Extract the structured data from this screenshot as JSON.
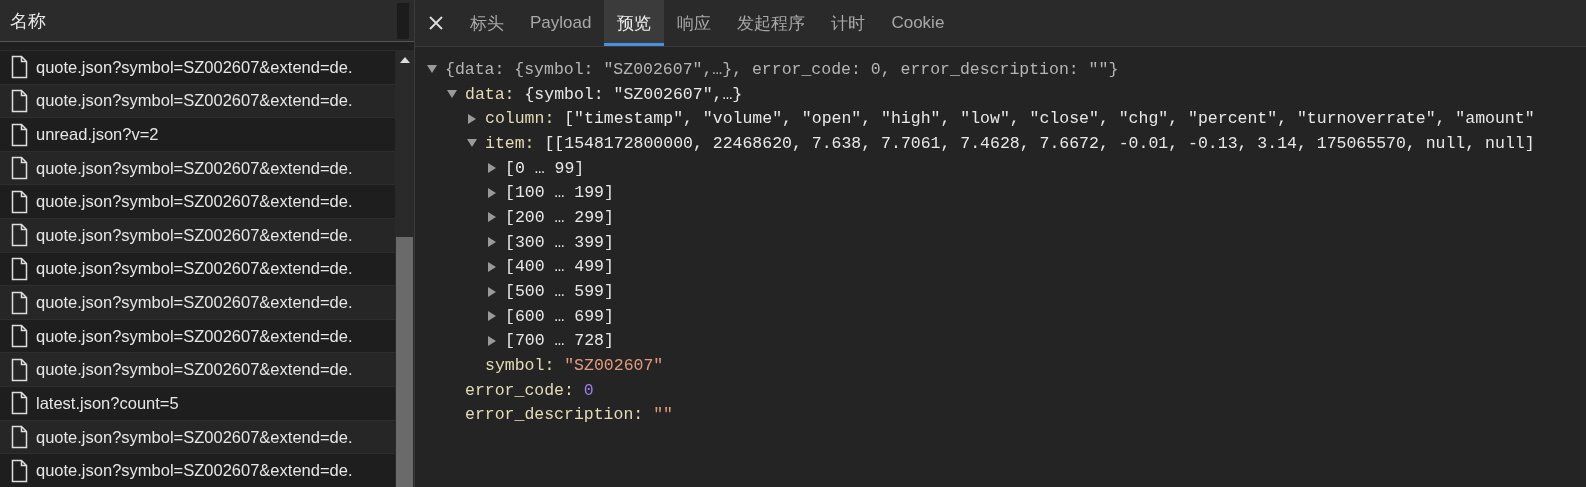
{
  "requests": {
    "header": "名称",
    "items": [
      {
        "name": "quote.json?symbol=SZ002607&extend=de."
      },
      {
        "name": "quote.json?symbol=SZ002607&extend=de."
      },
      {
        "name": "unread.json?v=2"
      },
      {
        "name": "quote.json?symbol=SZ002607&extend=de."
      },
      {
        "name": "quote.json?symbol=SZ002607&extend=de."
      },
      {
        "name": "quote.json?symbol=SZ002607&extend=de."
      },
      {
        "name": "quote.json?symbol=SZ002607&extend=de."
      },
      {
        "name": "quote.json?symbol=SZ002607&extend=de."
      },
      {
        "name": "quote.json?symbol=SZ002607&extend=de."
      },
      {
        "name": "quote.json?symbol=SZ002607&extend=de."
      },
      {
        "name": "latest.json?count=5"
      },
      {
        "name": "quote.json?symbol=SZ002607&extend=de."
      },
      {
        "name": "quote.json?symbol=SZ002607&extend=de."
      }
    ]
  },
  "tabs": [
    {
      "label": "标头",
      "selected": false
    },
    {
      "label": "Payload",
      "selected": false
    },
    {
      "label": "预览",
      "selected": true
    },
    {
      "label": "响应",
      "selected": false
    },
    {
      "label": "发起程序",
      "selected": false
    },
    {
      "label": "计时",
      "selected": false
    },
    {
      "label": "Cookie",
      "selected": false
    }
  ],
  "tree": [
    {
      "kind": "object",
      "summary": "{data: {symbol: \"SZ002607\",…}, error_code: 0, error_description: \"\"}",
      "expanded": true,
      "children": [
        {
          "kind": "object",
          "key": "data:",
          "summary": "{symbol: \"SZ002607\",…}",
          "expanded": true,
          "children": [
            {
              "kind": "object",
              "key": "column:",
              "summary": "[\"timestamp\", \"volume\", \"open\", \"high\", \"low\", \"close\", \"chg\", \"percent\", \"turnoverrate\", \"amount\"",
              "expanded": false
            },
            {
              "kind": "object",
              "key": "item:",
              "summary": "[[1548172800000, 22468620, 7.638, 7.7061, 7.4628, 7.6672, -0.01, -0.13, 3.14, 175065570, null, null]",
              "expanded": true,
              "children": [
                {
                  "kind": "object",
                  "summary": "[0 … 99]",
                  "expanded": false
                },
                {
                  "kind": "object",
                  "summary": "[100 … 199]",
                  "expanded": false
                },
                {
                  "kind": "object",
                  "summary": "[200 … 299]",
                  "expanded": false
                },
                {
                  "kind": "object",
                  "summary": "[300 … 399]",
                  "expanded": false
                },
                {
                  "kind": "object",
                  "summary": "[400 … 499]",
                  "expanded": false
                },
                {
                  "kind": "object",
                  "summary": "[500 … 599]",
                  "expanded": false
                },
                {
                  "kind": "object",
                  "summary": "[600 … 699]",
                  "expanded": false
                },
                {
                  "kind": "object",
                  "summary": "[700 … 728]",
                  "expanded": false
                }
              ]
            },
            {
              "kind": "string",
              "key": "symbol:",
              "value": "\"SZ002607\""
            }
          ]
        },
        {
          "kind": "number",
          "key": "error_code:",
          "value": "0"
        },
        {
          "kind": "string",
          "key": "error_description:",
          "value": "\"\""
        }
      ]
    }
  ]
}
